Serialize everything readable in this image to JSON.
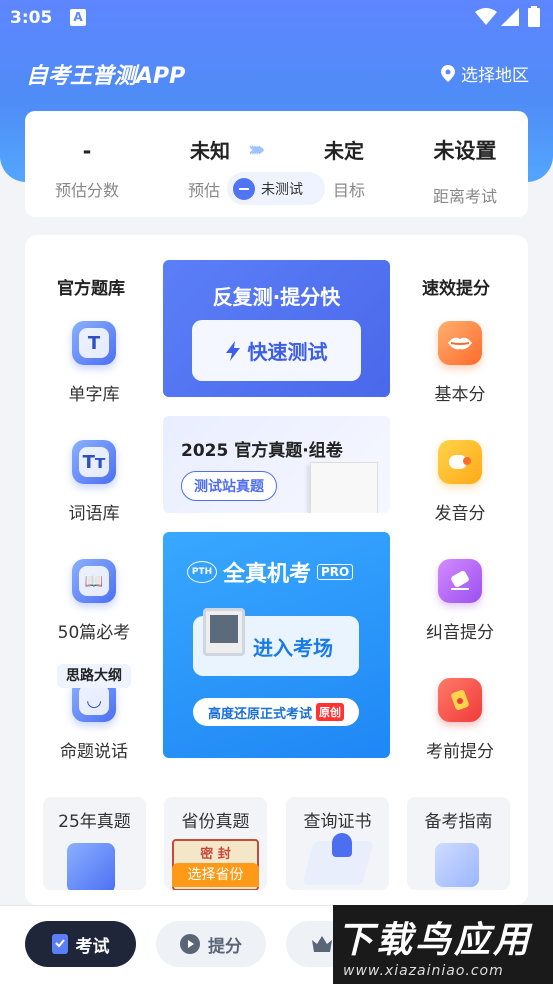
{
  "status": {
    "time": "3:05",
    "a_badge": "A"
  },
  "header": {
    "title": "自考王普测APP",
    "region": "选择地区"
  },
  "stats": {
    "score_value": "-",
    "score_label": "预估分数",
    "est_value": "未知",
    "est_label": "预估",
    "target_value": "未定",
    "target_label": "目标",
    "untested": "未测试",
    "exam_value": "未设置",
    "exam_label": "距离考试"
  },
  "left": {
    "heading": "官方题库",
    "items": [
      {
        "label": "单字库",
        "glyph": "T"
      },
      {
        "label": "词语库",
        "glyph": "Tт"
      },
      {
        "label": "50篇必考",
        "glyph": "📖"
      },
      {
        "label": "命题说话",
        "glyph": "◡"
      }
    ],
    "tag": "思路大纲"
  },
  "right": {
    "heading": "速效提分",
    "items": [
      {
        "label": "基本分",
        "color": "orange"
      },
      {
        "label": "发音分",
        "color": "yellow"
      },
      {
        "label": "纠音提分",
        "color": "purple"
      },
      {
        "label": "考前提分",
        "color": "red"
      }
    ]
  },
  "banner1": {
    "title": "反复测·提分快",
    "button": "快速测试"
  },
  "banner2": {
    "title": "2025 官方真题·组卷",
    "button": "测试站真题"
  },
  "banner3": {
    "logo": "全真机考",
    "pth": "PTH",
    "pro": "PRO",
    "button": "进入考场",
    "pill": "高度还原正式考试",
    "original": "原创"
  },
  "tiles": [
    {
      "label": "25年真题"
    },
    {
      "label": "省份真题",
      "badge": "选择省份",
      "stamp": "密 封"
    },
    {
      "label": "查询证书"
    },
    {
      "label": "备考指南"
    }
  ],
  "tabs": [
    {
      "label": "考试"
    },
    {
      "label": "提分"
    }
  ],
  "watermark": {
    "title": "下载鸟应用",
    "url": "www.xiazainiao.com"
  },
  "colors": {
    "primary": "#4f74f5",
    "header": "#5e86ff",
    "tab_active": "#20263a"
  }
}
